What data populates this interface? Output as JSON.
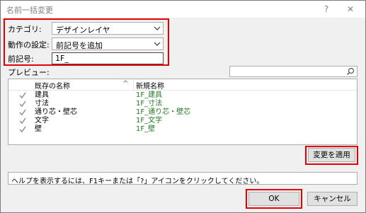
{
  "window": {
    "title": "名前一括変更",
    "help_label": "?",
    "close_label": "✕"
  },
  "form": {
    "category": {
      "label": "カテゴリ:",
      "value": "デザインレイヤ"
    },
    "action": {
      "label": "動作の設定:",
      "value": "前記号を追加"
    },
    "prefix": {
      "label": "前記号:",
      "value": "1F_"
    }
  },
  "preview": {
    "label": "プレビュー:",
    "search_placeholder": "",
    "columns": [
      "既存の名称",
      "新規名称"
    ],
    "sort_indicator": "^",
    "rows": [
      {
        "old": "建具",
        "new": "1F_建具"
      },
      {
        "old": "寸法",
        "new": "1F_寸法"
      },
      {
        "old": "通り芯・壁芯",
        "new": "1F_通り芯・壁芯"
      },
      {
        "old": "文字",
        "new": "1F_文字"
      },
      {
        "old": "壁",
        "new": "1F_壁"
      }
    ]
  },
  "buttons": {
    "apply": "変更を適用",
    "ok": "OK",
    "cancel": "キャンセル"
  },
  "help_text": "ヘルプを表示するには、F1キーまたは「?」アイコンをクリックしてください。",
  "colors": {
    "highlight": "#e50000",
    "new_name": "#1f7a1f",
    "window_bg": "#f0f0f0"
  }
}
